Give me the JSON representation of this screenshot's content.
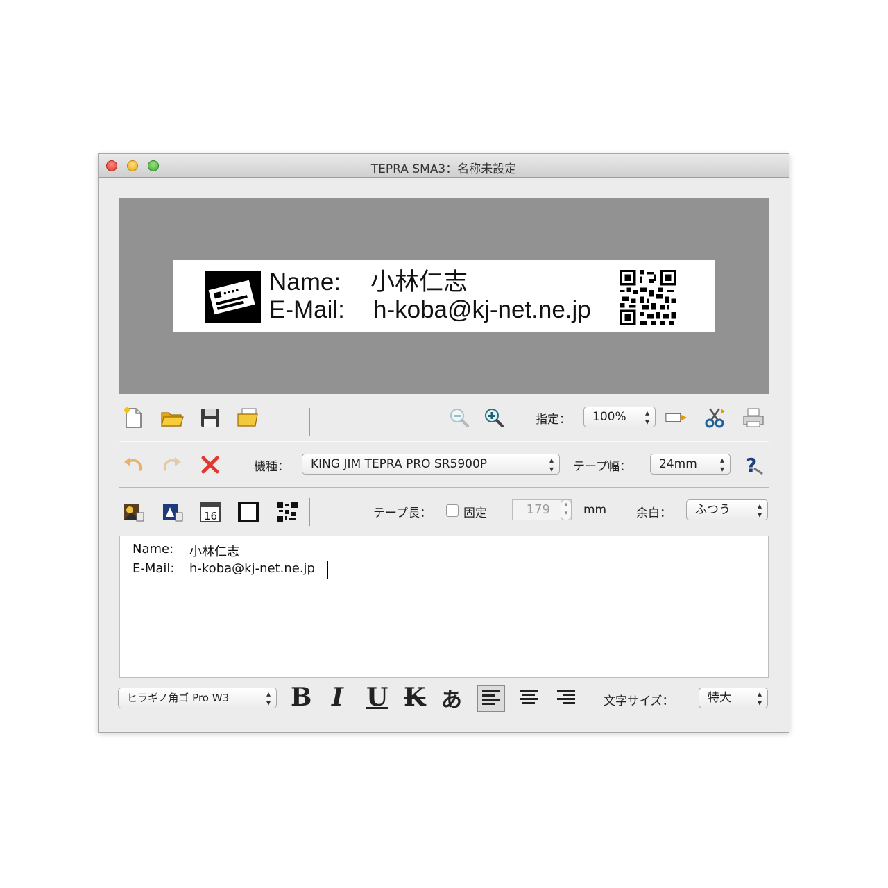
{
  "window": {
    "title": "TEPRA SMA3：名称未設定"
  },
  "preview": {
    "name_label": "Name:",
    "name_value": "小林仁志",
    "email_label": "E-Mail:",
    "email_value": "h-koba@kj-net.ne.jp"
  },
  "toolbar1": {
    "zoom_label": "指定：",
    "zoom_value": "100%"
  },
  "toolbar2": {
    "model_label": "機種：",
    "model_value": "KING JIM TEPRA PRO SR5900P",
    "tape_width_label": "テープ幅：",
    "tape_width_value": "24mm"
  },
  "toolbar3": {
    "calendar_day": "16",
    "tape_length_label": "テープ長：",
    "fixed_label": "固定",
    "fixed_checked": false,
    "length_value": "179",
    "length_unit": "mm",
    "margin_label": "余白：",
    "margin_value": "ふつう"
  },
  "editor": {
    "line1_label": "Name:",
    "line1_value": "小林仁志",
    "line2_label": "E-Mail:",
    "line2_value": "h-koba@kj-net.ne.jp"
  },
  "format_bar": {
    "font_value": "ヒラギノ角ゴ Pro W3",
    "bold": "B",
    "italic": "I",
    "underline": "U",
    "strike": "K",
    "vertical": "あ",
    "size_label": "文字サイズ：",
    "size_value": "特大"
  },
  "colors": {
    "preview_bg": "#929292",
    "window_bg": "#ececec",
    "delete_red": "#e03a2e"
  }
}
